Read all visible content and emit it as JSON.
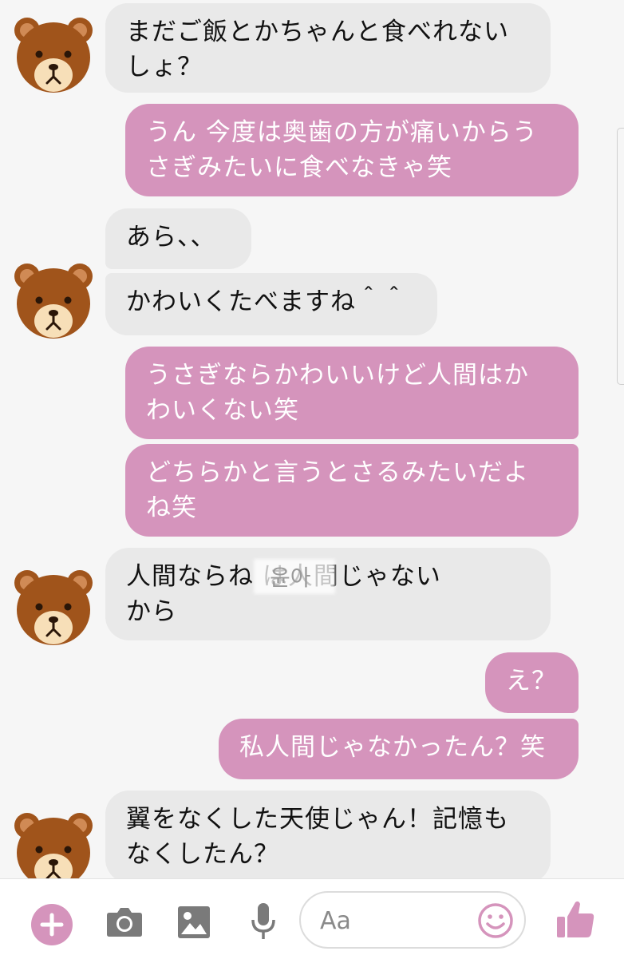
{
  "messages": [
    {
      "from": "other",
      "text": "まだご飯とかちゃんと食べれない\nしょ？"
    },
    {
      "from": "me",
      "text": "うん 今度は奥歯の方が痛いからう\nさぎみたいに食べなきゃ笑"
    },
    {
      "from": "other",
      "text": "あら、、"
    },
    {
      "from": "other",
      "text": "かわいくたべますね＾＾"
    },
    {
      "from": "me",
      "text": "うさぎならかわいいけど人間はか\nわいくない笑"
    },
    {
      "from": "me",
      "text": "どちらかと言うとさるみたいだよ\nね笑"
    },
    {
      "from": "other",
      "text": "人間ならね          は人間じゃない\nから",
      "redacted": "윤아"
    },
    {
      "from": "me",
      "text": "え？"
    },
    {
      "from": "me",
      "text": "私人間じゃなかったん？笑"
    },
    {
      "from": "other",
      "text": "翼をなくした天使じゃん！記憶も\nなくしたん？"
    }
  ],
  "composer": {
    "placeholder": "Aa",
    "icons": [
      "plus-icon",
      "camera-icon",
      "image-icon",
      "microphone-icon",
      "emoji-icon",
      "thumbs-up-icon"
    ]
  },
  "colors": {
    "accent": "#d594bc",
    "incoming_bubble": "#e9e9e9",
    "background": "#f6f6f6",
    "bear_brown": "#a0541b",
    "bear_muzzle": "#f7dfb8"
  }
}
